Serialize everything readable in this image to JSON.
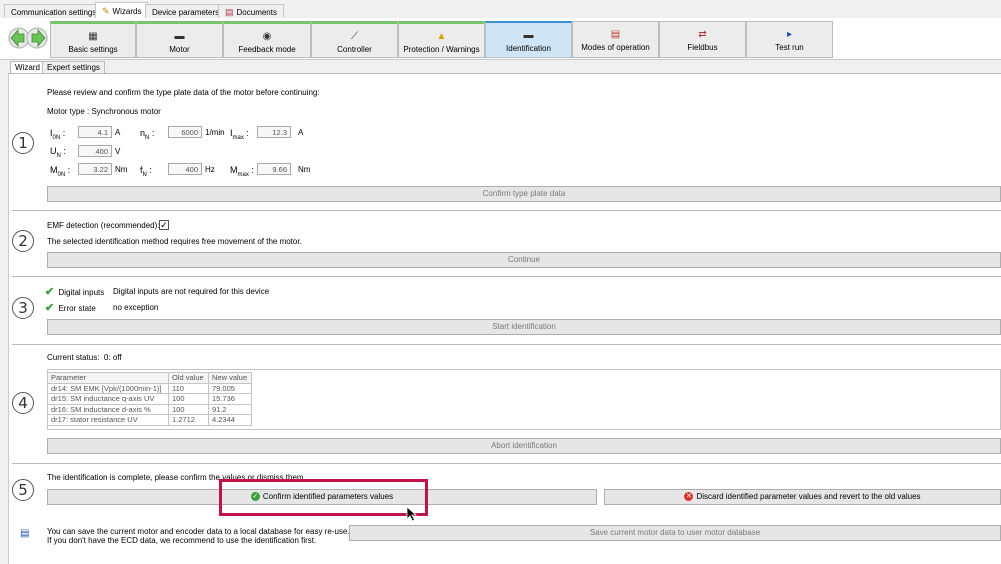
{
  "top_tabs": [
    {
      "label": "Communication settings"
    },
    {
      "label": "Wizards"
    },
    {
      "label": "Device parameters"
    },
    {
      "label": "Documents"
    }
  ],
  "wizard_steps": [
    {
      "label": "Basic settings",
      "icon": "settings-icon"
    },
    {
      "label": "Motor",
      "icon": "motor-icon"
    },
    {
      "label": "Feedback mode",
      "icon": "encoder-icon"
    },
    {
      "label": "Controller",
      "icon": "graph-icon"
    },
    {
      "label": "Protection / Warnings",
      "icon": "warning-icon"
    },
    {
      "label": "Identification",
      "icon": "motor-icon"
    },
    {
      "label": "Modes of operation",
      "icon": "modes-icon"
    },
    {
      "label": "Fieldbus",
      "icon": "arrows-icon"
    },
    {
      "label": "Test run",
      "icon": "play-icon"
    }
  ],
  "sub_tabs": [
    {
      "label": "Wizard"
    },
    {
      "label": "Expert settings"
    }
  ],
  "section1": {
    "number": "1",
    "intro": "Please review and confirm the type plate data of the motor before continuing:",
    "motor_type": "Motor type : Synchronous motor",
    "fields": {
      "i_label": "I",
      "i_sub": "0N",
      "i_value": "4.1",
      "i_unit": "A",
      "n_label": "n",
      "n_sub": "N",
      "n_value": "6000",
      "n_unit": "1/min",
      "imax_label": "I",
      "imax_sub": "max",
      "imax_value": "12.3",
      "imax_unit": "A",
      "u_label": "U",
      "u_sub": "N",
      "u_value": "400",
      "u_unit": "V",
      "m_label": "M",
      "m_sub": "0N",
      "m_value": "3.22",
      "m_unit": "Nm",
      "f_label": "f",
      "f_sub": "N",
      "f_value": "400",
      "f_unit": "Hz",
      "mmax_label": "M",
      "mmax_sub": "max",
      "mmax_value": "9.66",
      "mmax_unit": "Nm"
    },
    "button": "Confirm type plate data"
  },
  "section2": {
    "number": "2",
    "emf_label": "EMF detection (recommended):",
    "emf_checked": "✓",
    "note": "The selected identification method requires free movement of the motor.",
    "button": "Continue"
  },
  "section3": {
    "number": "3",
    "digital_label": "Digital inputs",
    "digital_value": "Digital inputs are not required for this device",
    "error_label": "Error state",
    "error_value": "no exception",
    "button": "Start identification"
  },
  "section4": {
    "number": "4",
    "status_label": "Current status:",
    "status_value": "0: off",
    "columns": [
      "Parameter",
      "Old value",
      "New value"
    ],
    "rows": [
      [
        "dr14: SM EMK [Vpk/(1000min-1)]",
        "110",
        "79.005"
      ],
      [
        "dr15: SM inductance q-axis UV",
        "100",
        "15.736"
      ],
      [
        "dr16: SM inductance d-axis %",
        "100",
        "91.2"
      ],
      [
        "dr17: stator resistance UV",
        "1.2712",
        "4.2344"
      ]
    ],
    "button": "Abort identification"
  },
  "section5": {
    "number": "5",
    "note": "The identification is complete, please confirm the values or dismiss them.",
    "confirm_button": "Confirm identified parameters values",
    "discard_button": "Discard identified parameter values and revert to the old values"
  },
  "footer": {
    "line1": "You can save the current motor and encoder data to a local database for easy re-use.",
    "line2": "If you don't have the ECD data, we recommend to use the identification first.",
    "save_button": "Save current motor data to user motor database"
  },
  "colors": {
    "highlight": "#c0134a",
    "check": "#3aa03a",
    "discard": "#d9342b",
    "active_step": "#cfe5f6"
  }
}
